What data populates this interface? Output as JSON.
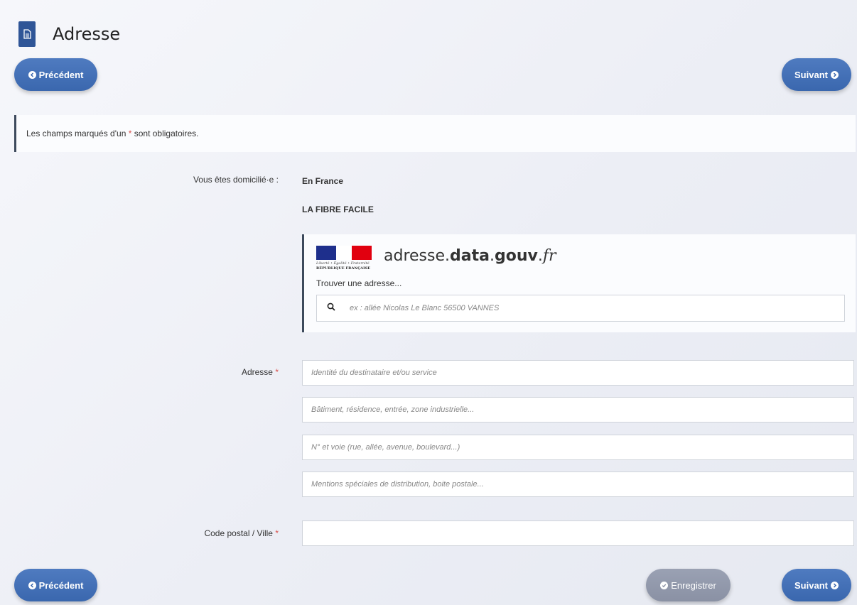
{
  "header": {
    "title": "Adresse",
    "icon": "document-icon"
  },
  "nav": {
    "prev_label": "Précédent",
    "next_label": "Suivant",
    "save_label": "Enregistrer"
  },
  "notice": {
    "prefix": "Les champs marqués d'un",
    "star": "*",
    "suffix": "sont obligatoires."
  },
  "domicile": {
    "label": "Vous êtes domicilié·e :",
    "value": "En France",
    "operator": "LA FIBRE FACILE"
  },
  "ban": {
    "motto": "Liberté • Égalité • Fraternité",
    "republique": "RÉPUBLIQUE FRANÇAISE",
    "brand_prefix": "adresse.",
    "brand_bold": "data",
    "brand_mid": ".",
    "brand_bold2": "gouv",
    "brand_mid2": ".",
    "brand_suffix": "fr",
    "hint": "Trouver une adresse...",
    "search_placeholder": "ex : allée Nicolas Le Blanc 56500 VANNES"
  },
  "address": {
    "label": "Adresse",
    "star": "*",
    "line1_placeholder": "Identité du destinataire et/ou service",
    "line2_placeholder": "Bâtiment, résidence, entrée, zone industrielle...",
    "line3_placeholder": "N° et voie (rue, allée, avenue, boulevard...)",
    "line4_placeholder": "Mentions spéciales de distribution, boite postale..."
  },
  "postal": {
    "label": "Code postal / Ville",
    "star": "*",
    "value": ""
  },
  "colors": {
    "primary": "#3a67ae",
    "secondary": "#8a91a4",
    "badge": "#2f5597",
    "required": "#d9534f"
  }
}
